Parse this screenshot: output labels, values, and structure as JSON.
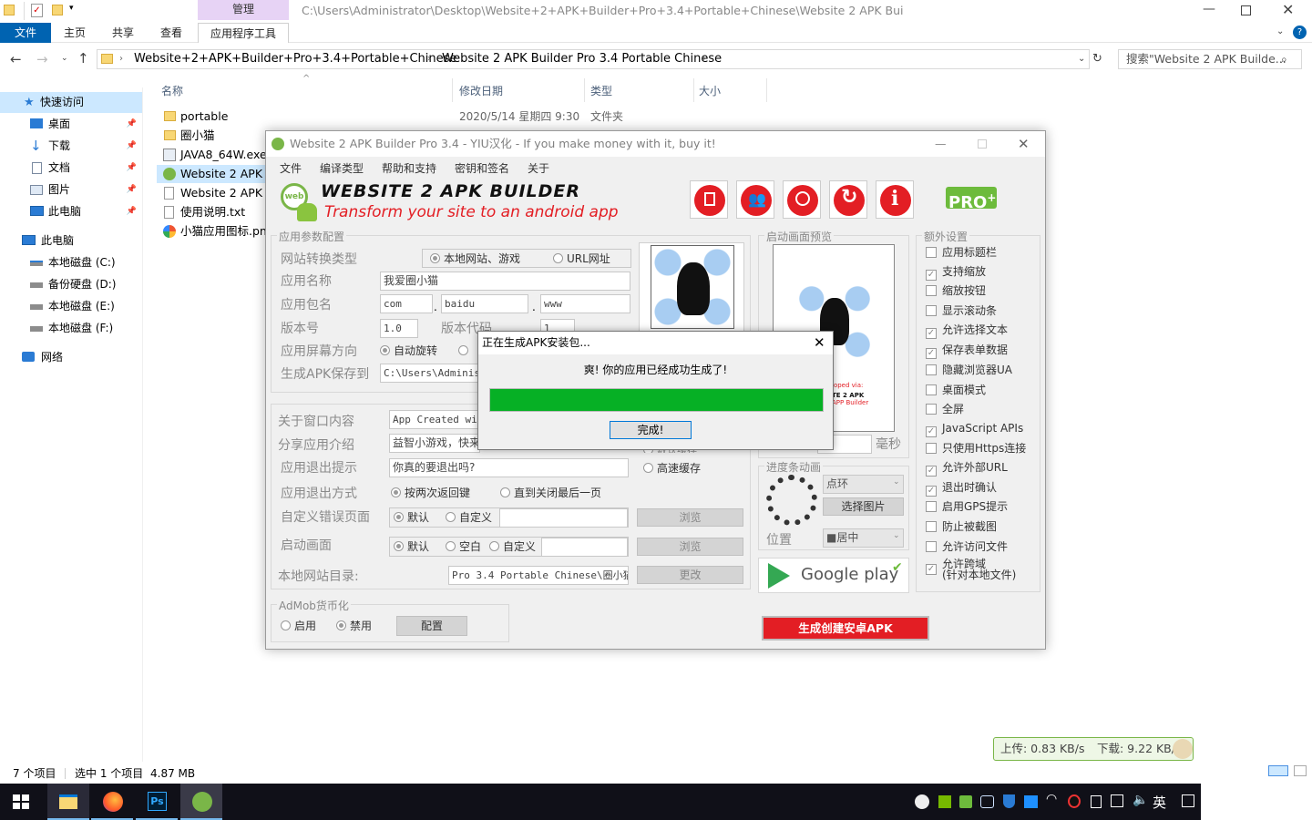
{
  "explorer": {
    "ribbon_context": "管理",
    "path_title": "C:\\Users\\Administrator\\Desktop\\Website+2+APK+Builder+Pro+3.4+Portable+Chinese\\Website 2 APK Bui",
    "tabs": [
      "文件",
      "主页",
      "共享",
      "查看",
      "应用程序工具"
    ],
    "breadcrumb": [
      "Website+2+APK+Builder+Pro+3.4+Portable+Chinese",
      "Website 2 APK Builder Pro 3.4 Portable Chinese"
    ],
    "search_placeholder": "搜索\"Website 2 APK Builde...",
    "nav": {
      "quick_access": "快速访问",
      "quick_items": [
        "桌面",
        "下载",
        "文档",
        "图片",
        "此电脑"
      ],
      "this_pc": "此电脑",
      "drives": [
        "本地磁盘 (C:)",
        "备份硬盘 (D:)",
        "本地磁盘 (E:)",
        "本地磁盘 (F:)"
      ],
      "network": "网络"
    },
    "columns": [
      "名称",
      "修改日期",
      "类型",
      "大小"
    ],
    "files": [
      {
        "name": "portable",
        "date": "2020/5/14 星期四 9:30",
        "type": "文件夹",
        "icon": "folder-icon"
      },
      {
        "name": "圈小猫",
        "date": "",
        "type": "",
        "icon": "folder-icon"
      },
      {
        "name": "JAVA8_64W.exe",
        "date": "",
        "type": "",
        "icon": "exe-icon"
      },
      {
        "name": "Website 2 APK E",
        "date": "",
        "type": "",
        "icon": "app-icon"
      },
      {
        "name": "Website 2 APK E",
        "date": "",
        "type": "",
        "icon": "file-icon"
      },
      {
        "name": "使用说明.txt",
        "date": "",
        "type": "",
        "icon": "txt-icon"
      },
      {
        "name": "小猫应用图标.png",
        "date": "",
        "type": "",
        "icon": "png-icon"
      }
    ],
    "status": {
      "count": "7 个项目",
      "selected": "选中 1 个项目",
      "size": "4.87 MB"
    },
    "net_speed": {
      "up": "上传: 0.83 KB/s",
      "down": "下载: 9.22 KB/s"
    }
  },
  "app": {
    "title": "Website 2 APK Builder Pro 3.4 - YIU汉化 - If you make money with it, buy it!",
    "menu": [
      "文件",
      "编译类型",
      "帮助和支持",
      "密钥和签名",
      "关于"
    ],
    "logo_title": "WEBSITE 2 APK BUILDER",
    "logo_sub": "Transform your site to an android app",
    "logo_badge": "web",
    "pro_badge": "PRO",
    "pro_plus": "+",
    "params": {
      "group_label": "应用参数配置",
      "type_label": "网站转换类型",
      "type_opt1": "本地网站、游戏",
      "type_opt2": "URL网址",
      "name_label": "应用名称",
      "name_value": "我爱圈小猫",
      "pkg_label": "应用包名",
      "pkg1": "com",
      "pkg2": "baidu",
      "pkg3": "www",
      "version_label": "版本号",
      "version_value": "1.0",
      "vcode_label": "版本代码",
      "vcode_value": "1",
      "orient_label": "应用屏幕方向",
      "orient_opt1": "自动旋转",
      "save_label": "生成APK保存到",
      "save_value": "C:\\Users\\Administr"
    },
    "lower": {
      "about_label": "关于窗口内容",
      "about_value": "App Created wit",
      "share_label": "分享应用介绍",
      "share_value": "益智小游戏，快来",
      "exit_label": "应用退出提示",
      "exit_value": "你真的要退出吗?",
      "exitmode_label": "应用退出方式",
      "exitmode_opt1": "按两次返回键",
      "exitmode_opt2": "直到关闭最后一页",
      "err_label": "自定义错误页面",
      "err_opt1": "默认",
      "err_opt2": "自定义",
      "splash_label": "启动画面",
      "splash_opt1": "默认",
      "splash_opt2": "空白",
      "splash_opt3": "自定义",
      "browse": "浏览",
      "localdir_label": "本地网站目录:",
      "localdir_value": "Pro 3.4 Portable Chinese\\圈小猫",
      "change": "更改",
      "cache_opt": "高速缓存",
      "cache_partial": "数认缓存"
    },
    "admob": {
      "label": "AdMob货币化",
      "opt_on": "启用",
      "opt_off": "禁用",
      "config": "配置"
    },
    "preview": {
      "label": "启动画面预览",
      "ms_value": "0",
      "ms_unit": "毫秒",
      "small_text1": "loped via:",
      "small_text2": "TE 2 APK",
      "small_text3": "APP Builder"
    },
    "progress_anim": {
      "label": "进度条动画",
      "style": "点环",
      "pick": "选择图片",
      "pos_label": "位置",
      "pos_value": "■居中"
    },
    "google_play": "Google play",
    "build_button": "生成创建安卓APK",
    "extra": {
      "label": "额外设置",
      "items": [
        {
          "text": "应用标题栏",
          "checked": false
        },
        {
          "text": "支持缩放",
          "checked": true
        },
        {
          "text": "缩放按钮",
          "checked": false
        },
        {
          "text": "显示滚动条",
          "checked": false
        },
        {
          "text": "允许选择文本",
          "checked": true
        },
        {
          "text": "保存表单数据",
          "checked": true
        },
        {
          "text": "隐藏浏览器UA",
          "checked": false
        },
        {
          "text": "桌面模式",
          "checked": false
        },
        {
          "text": "全屏",
          "checked": false
        },
        {
          "text": "JavaScript APIs",
          "checked": true
        },
        {
          "text": "只使用Https连接",
          "checked": false
        },
        {
          "text": "允许外部URL",
          "checked": true
        },
        {
          "text": "退出时确认",
          "checked": true
        },
        {
          "text": "启用GPS提示",
          "checked": false
        },
        {
          "text": "防止被截图",
          "checked": false
        },
        {
          "text": "允许访问文件",
          "checked": false
        },
        {
          "text": "允许跨域\n(针对本地文件)",
          "checked": true
        }
      ]
    }
  },
  "dialog": {
    "title": "正在生成APK安装包...",
    "message": "爽! 你的应用已经成功生成了!",
    "progress": 1.0,
    "ok": "完成!"
  },
  "taskbar": {
    "ime": "英"
  },
  "colors": {
    "accent": "#0063b1",
    "progress": "#06b025",
    "build": "#e31e24"
  }
}
